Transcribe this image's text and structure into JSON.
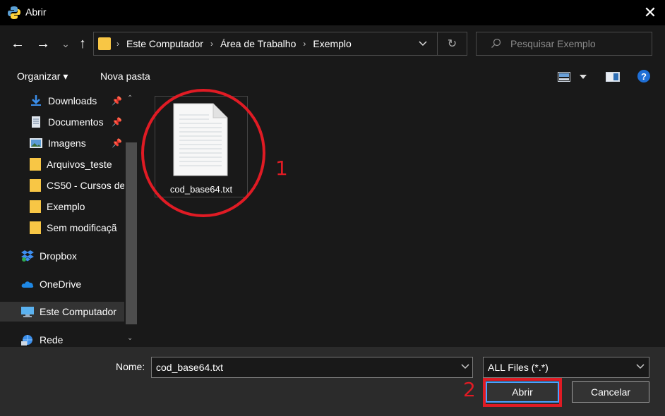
{
  "window": {
    "title": "Abrir",
    "close_glyph": "✕"
  },
  "nav": {
    "back_glyph": "←",
    "forward_glyph": "→",
    "recent_glyph": "⌄",
    "up_glyph": "↑",
    "breadcrumbs": [
      "Este Computador",
      "Área de Trabalho",
      "Exemplo"
    ],
    "breadcrumb_sep": "›",
    "refresh_glyph": "↻",
    "search_placeholder": "Pesquisar Exemplo"
  },
  "toolbar": {
    "organize_label": "Organizar ▾",
    "new_folder_label": "Nova pasta",
    "help_glyph": "?"
  },
  "sidebar": {
    "items": [
      {
        "label": "Downloads",
        "pinned": true
      },
      {
        "label": "Documentos",
        "pinned": true
      },
      {
        "label": "Imagens",
        "pinned": true
      },
      {
        "label": "Arquivos_teste",
        "pinned": false
      },
      {
        "label": "CS50 - Cursos de",
        "pinned": false
      },
      {
        "label": "Exemplo",
        "pinned": false
      },
      {
        "label": "Sem modificaçã",
        "pinned": false
      },
      {
        "label": "Dropbox",
        "pinned": false
      },
      {
        "label": "OneDrive",
        "pinned": false
      },
      {
        "label": "Este Computador",
        "pinned": false
      },
      {
        "label": "Rede",
        "pinned": false
      }
    ]
  },
  "content": {
    "files": [
      {
        "name": "cod_base64.txt",
        "type": "text-file-icon"
      }
    ]
  },
  "annotations": {
    "marker_1": "1",
    "marker_2": "2",
    "color": "#e01b24"
  },
  "footer": {
    "name_label": "Nome:",
    "name_value": "cod_base64.txt",
    "filetype_value": "ALL Files (*.*)",
    "open_label": "Abrir",
    "cancel_label": "Cancelar"
  },
  "colors": {
    "background": "#191919",
    "titlebar": "#000000",
    "footer": "#2b2b2b",
    "folder": "#f8c645",
    "accent": "#4aa0ff"
  }
}
